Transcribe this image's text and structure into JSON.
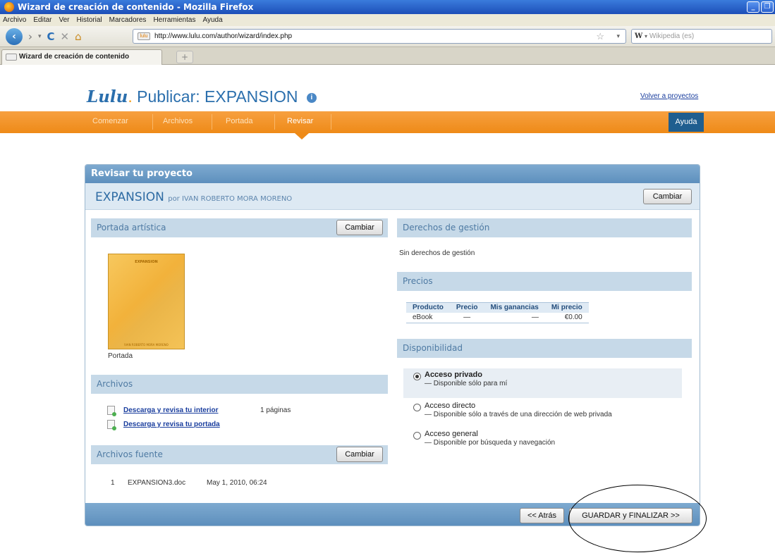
{
  "browser": {
    "window_title": "Wizard de creación de contenido - Mozilla Firefox",
    "menu": [
      "Archivo",
      "Editar",
      "Ver",
      "Historial",
      "Marcadores",
      "Herramientas",
      "Ayuda"
    ],
    "url": "http://www.lulu.com/author/wizard/index.php",
    "search_placeholder": "Wikipedia (es)",
    "search_engine_letter": "W",
    "tab_title": "Wizard de creación de contenido",
    "new_tab": "+"
  },
  "header": {
    "logo": "Lulu",
    "title": "Publicar: EXPANSION",
    "info_icon": "info-icon",
    "back_link": "Volver a proyectos"
  },
  "nav": {
    "items": [
      "Comenzar",
      "Archivos",
      "Portada",
      "Revisar"
    ],
    "active": "Revisar",
    "help": "Ayuda",
    "accent_color": "#ee8a17"
  },
  "review": {
    "panel_title": "Revisar tu proyecto",
    "project_name": "EXPANSION",
    "project_by": "por IVAN ROBERTO MORA MORENO",
    "change_label": "Cambiar"
  },
  "cover": {
    "section_title": "Portada artística",
    "change_label": "Cambiar",
    "caption": "Portada",
    "thumb_title": "EXPANSION",
    "thumb_author": "IVAN ROBERTO MORA MORENO"
  },
  "files": {
    "section_title": "Archivos",
    "items": [
      {
        "label": "Descarga y revisa tu interior",
        "pages": "1 páginas"
      },
      {
        "label": "Descarga y revisa tu portada",
        "pages": ""
      }
    ]
  },
  "source_files": {
    "section_title": "Archivos fuente",
    "change_label": "Cambiar",
    "rows": [
      {
        "num": "1",
        "name": "EXPANSION3.doc",
        "date": "May 1, 2010, 06:24"
      }
    ]
  },
  "rights": {
    "section_title": "Derechos de gestión",
    "text": "Sin derechos de gestión"
  },
  "prices": {
    "section_title": "Precios",
    "columns": [
      "Producto",
      "Precio",
      "Mis ganancias",
      "Mi precio"
    ],
    "rows": [
      {
        "producto": "eBook",
        "precio": "—",
        "ganancias": "—",
        "mi_precio": "€0.00"
      }
    ]
  },
  "availability": {
    "section_title": "Disponibilidad",
    "options": [
      {
        "label": "Acceso privado",
        "desc": "— Disponible sólo para mí",
        "selected": true
      },
      {
        "label": "Acceso directo",
        "desc": "— Disponible sólo a través de una dirección de web privada",
        "selected": false
      },
      {
        "label": "Acceso general",
        "desc": "— Disponible por búsqueda y navegación",
        "selected": false
      }
    ]
  },
  "footer": {
    "back_label": "<< Atrás",
    "finish_label": "GUARDAR y FINALIZAR >>"
  }
}
